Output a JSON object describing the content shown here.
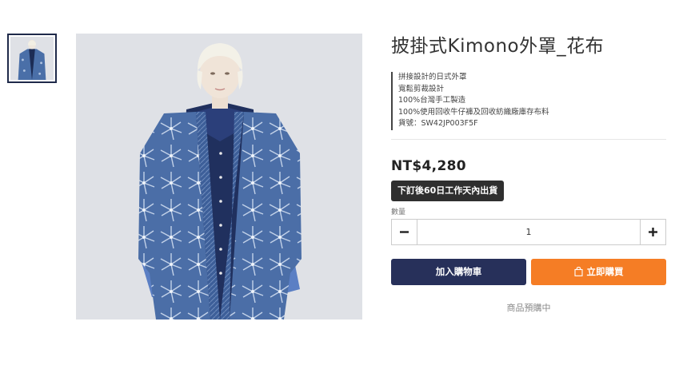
{
  "product": {
    "title": "披掛式Kimono外罩_花布",
    "features": [
      "拼接設計的日式外罩",
      "寬鬆剪裁設計",
      "100%台灣手工製造",
      "100%使用回收牛仔褲及回收紡織廠庫存布料",
      "貨號：SW42JP003F5F"
    ],
    "price": "NT$4,280",
    "shipping_badge": "下訂後60日工作天內出貨",
    "quantity_label": "數量",
    "quantity_value": "1",
    "add_to_cart_label": "加入購物車",
    "buy_now_label": "立即購買",
    "preorder_note": "商品預購中"
  },
  "icons": {
    "minus": "minus-icon",
    "plus": "plus-icon",
    "bag": "shopping-bag-icon"
  },
  "colors": {
    "cart_button": "#27305a",
    "buy_button": "#f57d25",
    "badge": "#2f2f2f"
  }
}
